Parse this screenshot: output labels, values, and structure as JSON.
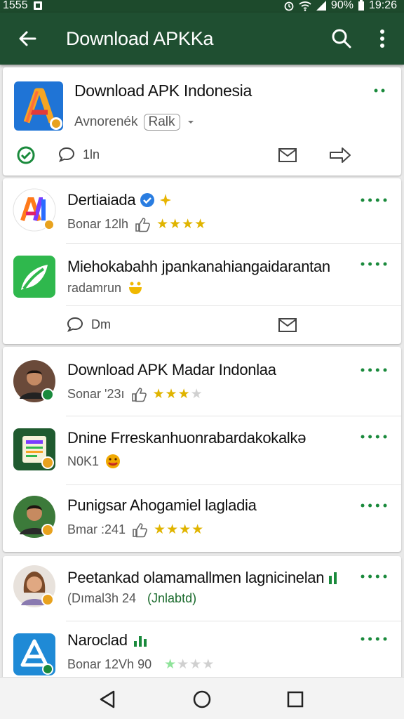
{
  "status_bar": {
    "time_left": "1555",
    "battery": "90%",
    "time_right": "19:26"
  },
  "app_bar": {
    "title": "Download APKKa"
  },
  "colors": {
    "brand_green": "#1f4f31",
    "accent_green": "#1a8a3c",
    "star_gold": "#e0b400"
  },
  "header_card": {
    "app_name": "Download APK Indonesia",
    "subtitle": "Avnorenék",
    "tag": "Ralk",
    "comment_count": "1ln"
  },
  "card2": {
    "items": [
      {
        "name": "Dertiaiada",
        "meta": "Bonar 12lh",
        "stars_filled": 4,
        "stars_total": 4
      },
      {
        "name": "Miehokabahh jpankanahiangaidarantan",
        "meta": "radamrun"
      }
    ],
    "comment_label": "Dm"
  },
  "card3": {
    "items": [
      {
        "name": "Download APK Madar Indonlaa",
        "meta": "Sonar '23ı",
        "stars_filled": 3,
        "stars_total": 4
      },
      {
        "name": "Dnine Frreskanhuonrabardakokalkə",
        "meta": "N0K1"
      },
      {
        "name": "Punigsar Ahogamiel lagladia",
        "meta": "Bmar :241",
        "stars_filled": 4,
        "stars_total": 4
      }
    ]
  },
  "card4": {
    "items": [
      {
        "name": "Peetankad olamamallmen lagnicinelan",
        "meta": "(Dımal3h 24",
        "meta_tag": "(Jnlabtd)"
      },
      {
        "name": "Naroclad",
        "meta": "Bonar 12Vh  90",
        "stars_filled": 1,
        "stars_total": 4
      }
    ]
  },
  "icons": [
    "back-arrow-icon",
    "search-icon",
    "more-vert-icon",
    "share-icon",
    "comment-icon",
    "mail-icon",
    "forward-icon",
    "verified-badge-icon",
    "star-icon",
    "nav-back-icon",
    "nav-home-icon",
    "nav-recents-icon"
  ]
}
